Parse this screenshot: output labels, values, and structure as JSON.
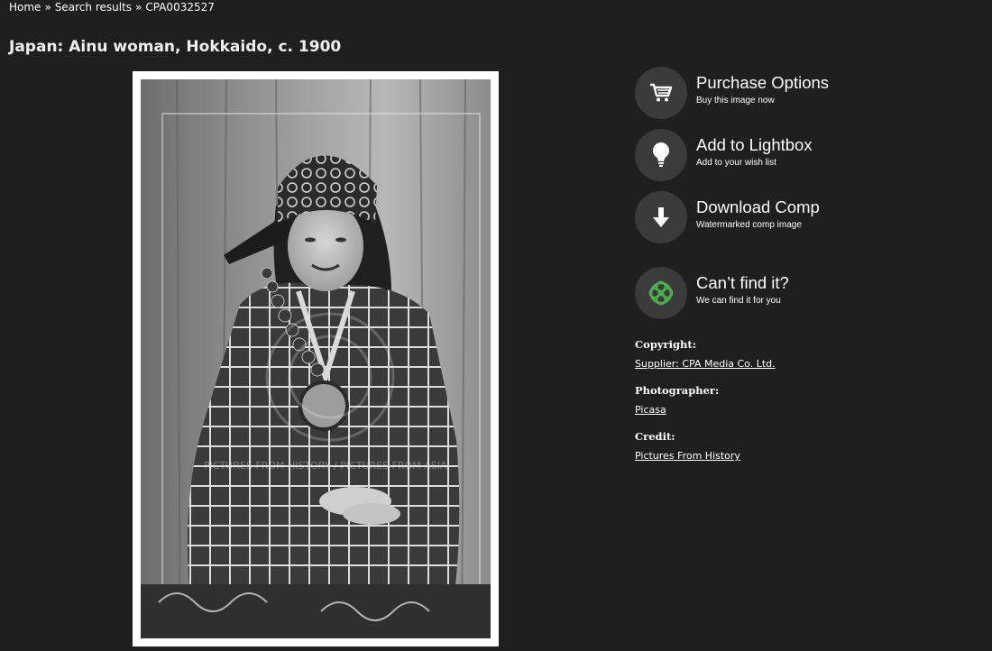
{
  "breadcrumb": {
    "items": [
      "Home",
      "Search results",
      "CPA0032527"
    ],
    "separator": "»"
  },
  "page_title": "Japan: Ainu woman, Hokkaido, c. 1900",
  "photo": {
    "alt": "Japan: Ainu woman, Hokkaido, c. 1900",
    "watermark": "PICTURES FROM HISTORY / PICTURES FROM ASIA"
  },
  "actions": [
    {
      "title": "Purchase Options",
      "subtitle": "Buy this image now",
      "icon": "cart-icon"
    },
    {
      "title": "Add to Lightbox",
      "subtitle": "Add to your wish list",
      "icon": "lightbulb-icon"
    },
    {
      "title": "Download Comp",
      "subtitle": "Watermarked comp image",
      "icon": "download-arrow-icon"
    },
    {
      "title": "Can’t find it?",
      "subtitle": "We can find it for you",
      "icon": "celtic-knot-icon"
    }
  ],
  "metadata": {
    "copyright_label": "Copyright:",
    "copyright_value": "Supplier: CPA Media Co. Ltd.",
    "photographer_label": "Photographer:",
    "photographer_value": "Picasa",
    "credit_label": "Credit:",
    "credit_value": "Pictures From History"
  },
  "colors": {
    "background": "#1f1f1f",
    "icon_circle": "#3b3b3b",
    "knot_green": "#4caf50"
  }
}
